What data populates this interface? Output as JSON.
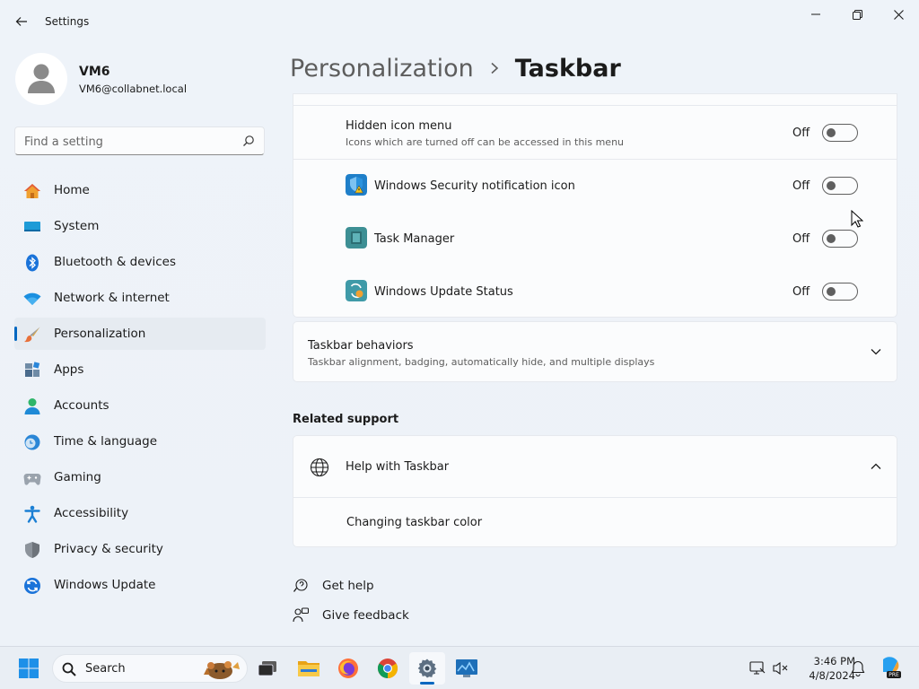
{
  "window": {
    "title": "Settings",
    "controls": [
      "minimize",
      "maximize",
      "close"
    ]
  },
  "user": {
    "name": "VM6",
    "email": "VM6@collabnet.local"
  },
  "search": {
    "placeholder": "Find a setting"
  },
  "sidebar": {
    "items": [
      {
        "label": "Home",
        "icon": "home-icon"
      },
      {
        "label": "System",
        "icon": "system-icon"
      },
      {
        "label": "Bluetooth & devices",
        "icon": "bluetooth-icon"
      },
      {
        "label": "Network & internet",
        "icon": "wifi-icon"
      },
      {
        "label": "Personalization",
        "icon": "brush-icon",
        "active": true
      },
      {
        "label": "Apps",
        "icon": "apps-icon"
      },
      {
        "label": "Accounts",
        "icon": "person-icon"
      },
      {
        "label": "Time & language",
        "icon": "clock-globe-icon"
      },
      {
        "label": "Gaming",
        "icon": "gamepad-icon"
      },
      {
        "label": "Accessibility",
        "icon": "accessibility-icon"
      },
      {
        "label": "Privacy & security",
        "icon": "shield-icon"
      },
      {
        "label": "Windows Update",
        "icon": "update-icon"
      }
    ]
  },
  "header": {
    "parent": "Personalization",
    "separator": ">",
    "current": "Taskbar"
  },
  "hidden_icon_menu": {
    "title": "Hidden icon menu",
    "subtitle": "Icons which are turned off can be accessed in this menu",
    "state": "Off",
    "items": [
      {
        "label": "Windows Security notification icon",
        "state": "Off",
        "icon": "windows-security-icon"
      },
      {
        "label": "Task Manager",
        "state": "Off",
        "icon": "task-manager-icon"
      },
      {
        "label": "Windows Update Status",
        "state": "Off",
        "icon": "windows-update-status-icon"
      }
    ]
  },
  "taskbar_behaviors": {
    "title": "Taskbar behaviors",
    "subtitle": "Taskbar alignment, badging, automatically hide, and multiple displays"
  },
  "related_support": {
    "title": "Related support",
    "help_title": "Help with Taskbar",
    "links": [
      "Changing taskbar color"
    ]
  },
  "footer_links": {
    "get_help": "Get help",
    "give_feedback": "Give feedback"
  },
  "taskbar": {
    "search_label": "Search",
    "time": "3:46 PM",
    "date": "4/8/2024",
    "apps": [
      "start-icon",
      "task-view-icon",
      "file-explorer-icon",
      "firefox-icon",
      "chrome-icon",
      "settings-icon",
      "monitor-app-icon"
    ]
  },
  "colors": {
    "accent": "#0067c0",
    "background": "#eef3f9",
    "card": "#fbfcfd"
  }
}
